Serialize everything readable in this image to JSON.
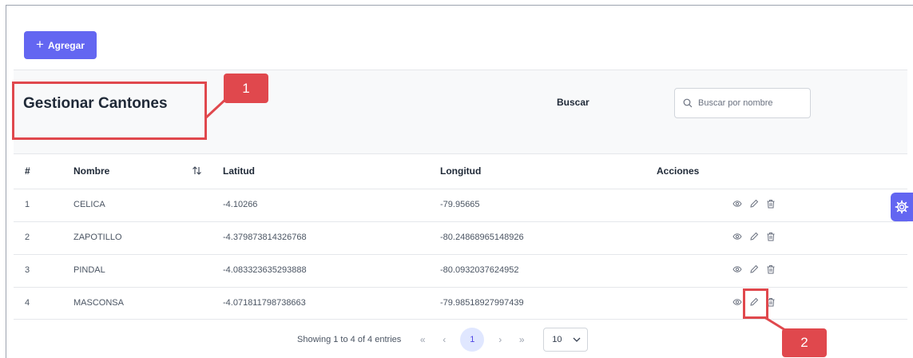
{
  "toolbar": {
    "add_label": "Agregar"
  },
  "header": {
    "title": "Gestionar Cantones",
    "search_label": "Buscar",
    "search_placeholder": "Buscar por nombre"
  },
  "table": {
    "columns": [
      "#",
      "Nombre",
      "Latitud",
      "Longitud",
      "Acciones"
    ],
    "rows": [
      {
        "num": "1",
        "nombre": "CELICA",
        "latitud": "-4.10266",
        "longitud": "-79.95665"
      },
      {
        "num": "2",
        "nombre": "ZAPOTILLO",
        "latitud": "-4.379873814326768",
        "longitud": "-80.24868965148926"
      },
      {
        "num": "3",
        "nombre": "PINDAL",
        "latitud": "-4.083323635293888",
        "longitud": "-80.0932037624952"
      },
      {
        "num": "4",
        "nombre": "MASCONSA",
        "latitud": "-4.071811798738663",
        "longitud": "-79.98518927997439"
      }
    ]
  },
  "pagination": {
    "summary": "Showing 1 to 4 of 4 entries",
    "first": "«",
    "prev": "‹",
    "current_page": "1",
    "next": "›",
    "last": "»",
    "rows_per_page": "10"
  },
  "annotations": {
    "callout_1": "1",
    "callout_2": "2"
  },
  "icons": {
    "view": "eye-icon",
    "edit": "pencil-icon",
    "delete": "trash-icon",
    "settings": "gear-icon",
    "search": "search-icon",
    "sort": "sort-icon"
  },
  "colors": {
    "accent": "#6366f1",
    "annotation": "#e0484d"
  }
}
